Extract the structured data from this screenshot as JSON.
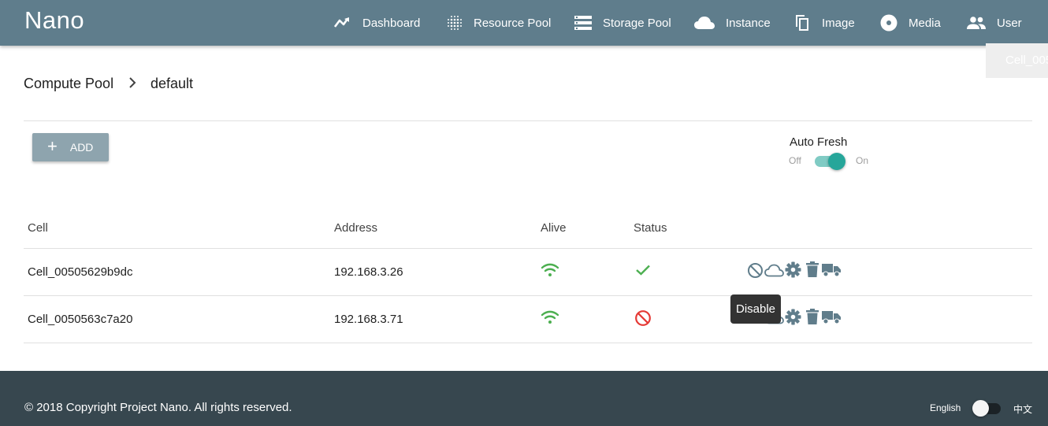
{
  "app": {
    "brand": "Nano"
  },
  "nav": {
    "dashboard": "Dashboard",
    "resource_pool": "Resource Pool",
    "storage_pool": "Storage Pool",
    "instance": "Instance",
    "image": "Image",
    "media": "Media",
    "user": "User"
  },
  "notification": {
    "text": "Cell_0050"
  },
  "breadcrumb": {
    "parent": "Compute Pool",
    "current": "default"
  },
  "toolbar": {
    "add_label": "ADD"
  },
  "auto_fresh": {
    "label": "Auto Fresh",
    "off_label": "Off",
    "on_label": "On",
    "enabled": true
  },
  "table": {
    "headers": {
      "cell": "Cell",
      "address": "Address",
      "alive": "Alive",
      "status": "Status"
    },
    "rows": [
      {
        "cell": "Cell_00505629b9dc",
        "address": "192.168.3.26",
        "alive": "wifi-icon",
        "status": "check-icon"
      },
      {
        "cell": "Cell_0050563c7a20",
        "address": "192.168.3.71",
        "alive": "wifi-icon",
        "status": "block-icon"
      }
    ],
    "row_actions": [
      "disable-icon",
      "cloud-icon",
      "gear-icon",
      "trash-icon",
      "truck-icon"
    ]
  },
  "tooltip": {
    "text": "Disable"
  },
  "footer": {
    "copyright": "© 2018 Copyright Project Nano. All rights reserved.",
    "lang_en": "English",
    "lang_zh": "中文"
  },
  "colors": {
    "topbar": "#5f7d8c",
    "footer": "#37474f",
    "accent": "#26a69a",
    "alive_green": "#4caf50",
    "error_red": "#e53935",
    "action_icon": "#607d8b"
  }
}
